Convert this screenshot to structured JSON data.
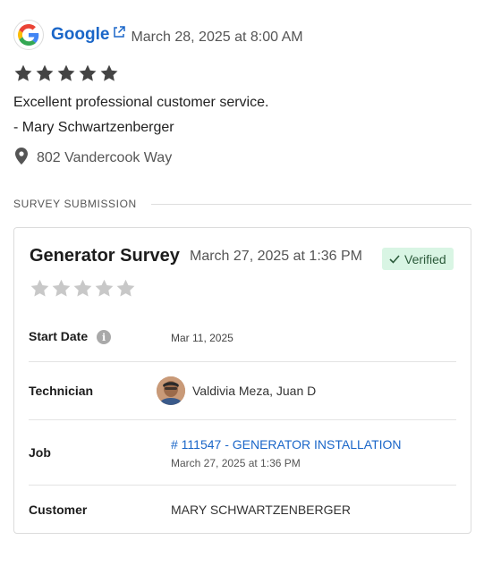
{
  "review": {
    "source": "Google",
    "source_icon": "google-logo",
    "date": "March 28, 2025 at 8:00 AM",
    "rating": 5,
    "max_rating": 5,
    "text": "Excellent professional customer service.",
    "author": "- Mary Schwartzenberger",
    "location": "802 Vandercook Way"
  },
  "section": {
    "label": "SURVEY SUBMISSION"
  },
  "survey": {
    "title": "Generator Survey",
    "date": "March 27, 2025 at 1:36 PM",
    "verified_label": "Verified",
    "rating": 0,
    "max_rating": 5,
    "rows": {
      "start_date_label": "Start Date",
      "start_date_value": "Mar 11, 2025",
      "technician_label": "Technician",
      "technician_value": "Valdivia Meza, Juan D",
      "job_label": "Job",
      "job_value": "# 111547 - GENERATOR INSTALLATION",
      "job_date": "March 27, 2025 at 1:36 PM",
      "customer_label": "Customer",
      "customer_value": "MARY SCHWARTZENBERGER"
    }
  },
  "colors": {
    "link": "#1a66c8",
    "star_filled": "#444444",
    "star_empty": "#c8c8c8",
    "verified_bg": "#d9f5e4"
  }
}
